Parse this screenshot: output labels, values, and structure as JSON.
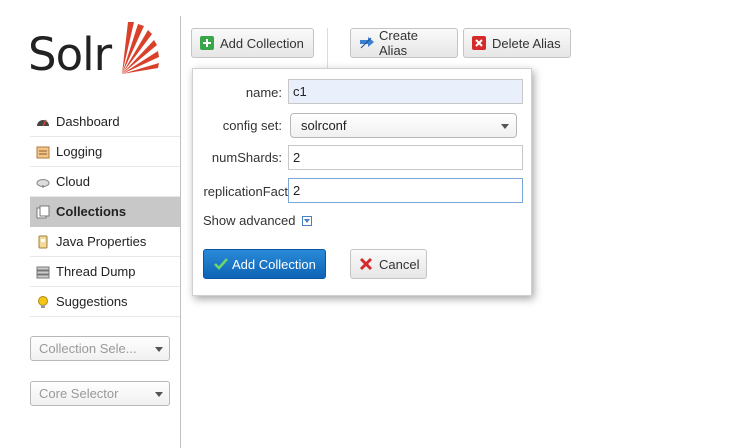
{
  "logo": {
    "text": "Solr"
  },
  "sidebar": {
    "items": [
      {
        "label": "Dashboard",
        "icon": "dashboard-icon"
      },
      {
        "label": "Logging",
        "icon": "logging-icon"
      },
      {
        "label": "Cloud",
        "icon": "cloud-icon"
      },
      {
        "label": "Collections",
        "icon": "collections-icon",
        "active": true
      },
      {
        "label": "Java Properties",
        "icon": "java-properties-icon"
      },
      {
        "label": "Thread Dump",
        "icon": "thread-dump-icon"
      },
      {
        "label": "Suggestions",
        "icon": "suggestions-icon"
      }
    ],
    "collection_selector": "Collection Sele...",
    "core_selector": "Core Selector"
  },
  "toolbar": {
    "add_collection": "Add Collection",
    "create_alias": "Create Alias",
    "delete_alias": "Delete Alias"
  },
  "dialog": {
    "name_label": "name:",
    "name_value": "c1",
    "config_label": "config set:",
    "config_value": "solrconf",
    "shards_label": "numShards:",
    "shards_value": "2",
    "replication_label": "replicationFact",
    "replication_value": "2",
    "show_advanced": "Show advanced",
    "add_button": "Add Collection",
    "cancel_button": "Cancel"
  },
  "colors": {
    "accent": "#d9412b",
    "primary_button": "#1a73c4",
    "active_menu": "#c8c8c8"
  }
}
